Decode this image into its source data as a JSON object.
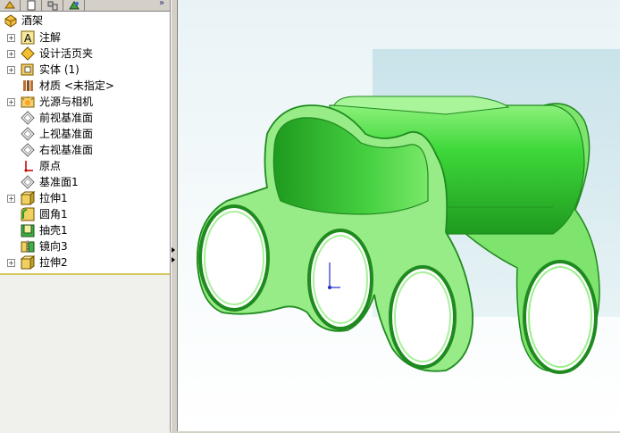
{
  "tree": {
    "root_label": "酒架",
    "items": [
      {
        "label": "注解",
        "expandable": true
      },
      {
        "label": "设计活页夹",
        "expandable": true
      },
      {
        "label": "实体 (1)",
        "expandable": true
      },
      {
        "label": "材质 <未指定>",
        "expandable": false
      },
      {
        "label": "光源与相机",
        "expandable": true
      },
      {
        "label": "前视基准面",
        "expandable": false
      },
      {
        "label": "上视基准面",
        "expandable": false
      },
      {
        "label": "右视基准面",
        "expandable": false
      },
      {
        "label": "原点",
        "expandable": false
      },
      {
        "label": "基准面1",
        "expandable": false
      },
      {
        "label": "拉伸1",
        "expandable": true
      },
      {
        "label": "圆角1",
        "expandable": false
      },
      {
        "label": "抽壳1",
        "expandable": false
      },
      {
        "label": "镜向3",
        "expandable": false
      },
      {
        "label": "拉伸2",
        "expandable": true
      }
    ]
  },
  "colors": {
    "model_green": "#33cc33",
    "model_light": "#99ee88",
    "model_dark": "#1f8f1f",
    "viewport_bg": "#eef6f8"
  },
  "icons": {
    "part": "part-icon",
    "annotation": "annotation-icon",
    "binder": "design-binder-icon",
    "solid": "solid-body-icon",
    "material": "material-icon",
    "lights": "lights-camera-icon",
    "plane": "plane-icon",
    "origin": "origin-icon",
    "extrude": "extrude-icon",
    "fillet": "fillet-icon",
    "shell": "shell-icon",
    "mirror": "mirror-icon"
  }
}
